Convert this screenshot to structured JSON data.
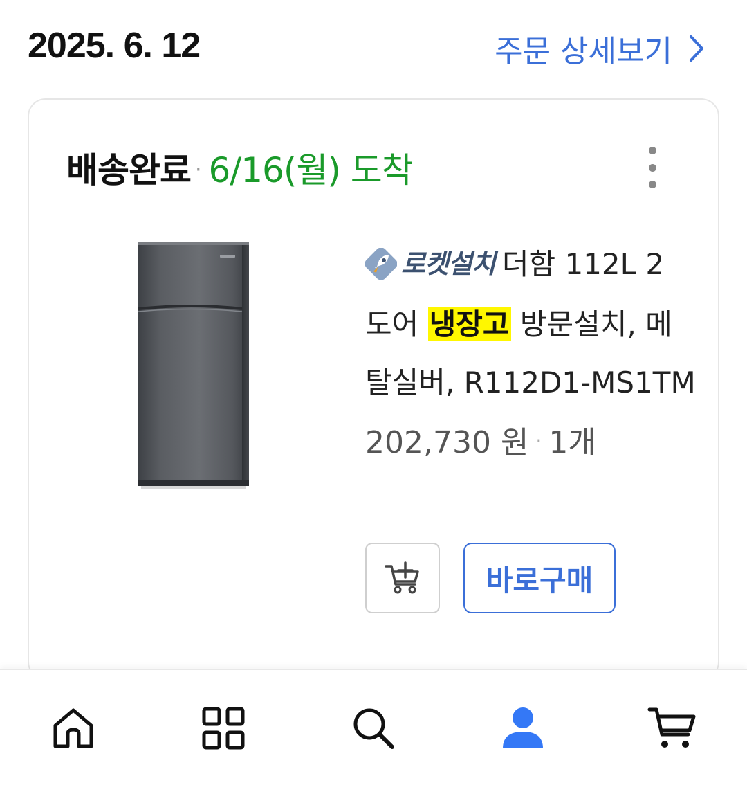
{
  "order": {
    "date": "2025. 6. 12",
    "detail_link_label": "주문 상세보기"
  },
  "shipment": {
    "status": "배송완료",
    "separator": "·",
    "arrival": "6/16(월) 도착"
  },
  "product": {
    "badge_label": "로켓설치",
    "title_before": "더함 112L 2 도어 ",
    "title_highlight": "냉장고",
    "title_after": " 방문설치, 메탈실버, R112D1-MS1TM",
    "price": "202,730 원",
    "price_separator": "·",
    "quantity": "1개",
    "image_alt": "refrigerator-product-image"
  },
  "actions": {
    "buy_now_label": "바로구매",
    "add_to_cart_icon": "cart-add-icon"
  },
  "bottom_nav": {
    "items": [
      {
        "name": "home",
        "icon": "home-icon",
        "active": false
      },
      {
        "name": "categories",
        "icon": "grid-icon",
        "active": false
      },
      {
        "name": "search",
        "icon": "search-icon",
        "active": false
      },
      {
        "name": "my-page",
        "icon": "person-icon",
        "active": true
      },
      {
        "name": "cart",
        "icon": "cart-icon",
        "active": false
      }
    ]
  },
  "colors": {
    "accent_blue": "#3b6fd8",
    "delivered_green": "#1a9a2a",
    "highlight_yellow": "#fff700",
    "active_nav": "#3478f6"
  }
}
